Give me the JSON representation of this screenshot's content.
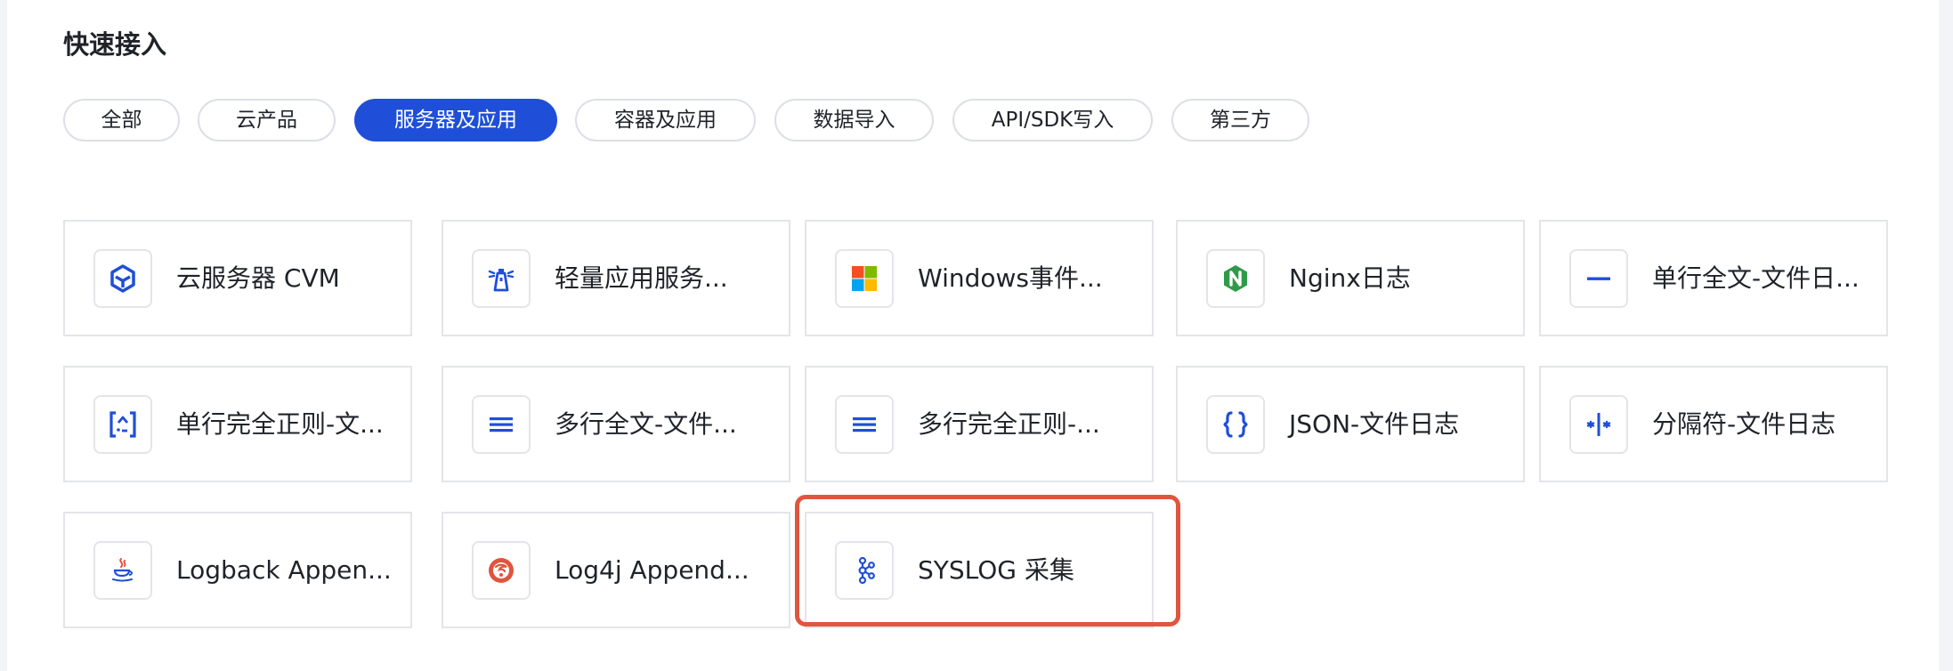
{
  "section": {
    "title": "快速接入"
  },
  "tabs": [
    {
      "label": "全部",
      "active": false
    },
    {
      "label": "云产品",
      "active": false
    },
    {
      "label": "服务器及应用",
      "active": true
    },
    {
      "label": "容器及应用",
      "active": false
    },
    {
      "label": "数据导入",
      "active": false
    },
    {
      "label": "API/SDK写入",
      "active": false
    },
    {
      "label": "第三方",
      "active": false
    }
  ],
  "cards": [
    {
      "label": "云服务器 CVM",
      "icon": "cube-icon"
    },
    {
      "label": "轻量应用服务...",
      "icon": "lighthouse-icon"
    },
    {
      "label": "Windows事件...",
      "icon": "windows-icon"
    },
    {
      "label": "Nginx日志",
      "icon": "nginx-icon"
    },
    {
      "label": "单行全文-文件日...",
      "icon": "single-line-icon"
    },
    {
      "label": "单行完全正则-文...",
      "icon": "regex-bracket-icon"
    },
    {
      "label": "多行全文-文件...",
      "icon": "multi-line-icon"
    },
    {
      "label": "多行完全正则-...",
      "icon": "multi-line-icon"
    },
    {
      "label": "JSON-文件日志",
      "icon": "curly-braces-icon"
    },
    {
      "label": "分隔符-文件日志",
      "icon": "separator-icon"
    },
    {
      "label": "Logback Appen...",
      "icon": "java-cup-icon"
    },
    {
      "label": "Log4j Append...",
      "icon": "log4j-icon"
    },
    {
      "label": "SYSLOG 采集",
      "icon": "kafka-nodes-icon"
    }
  ],
  "colors": {
    "accent": "#1f4fd8",
    "highlight": "#e0553d",
    "nginx": "#2f9a48",
    "log4j": "#e0553d"
  }
}
